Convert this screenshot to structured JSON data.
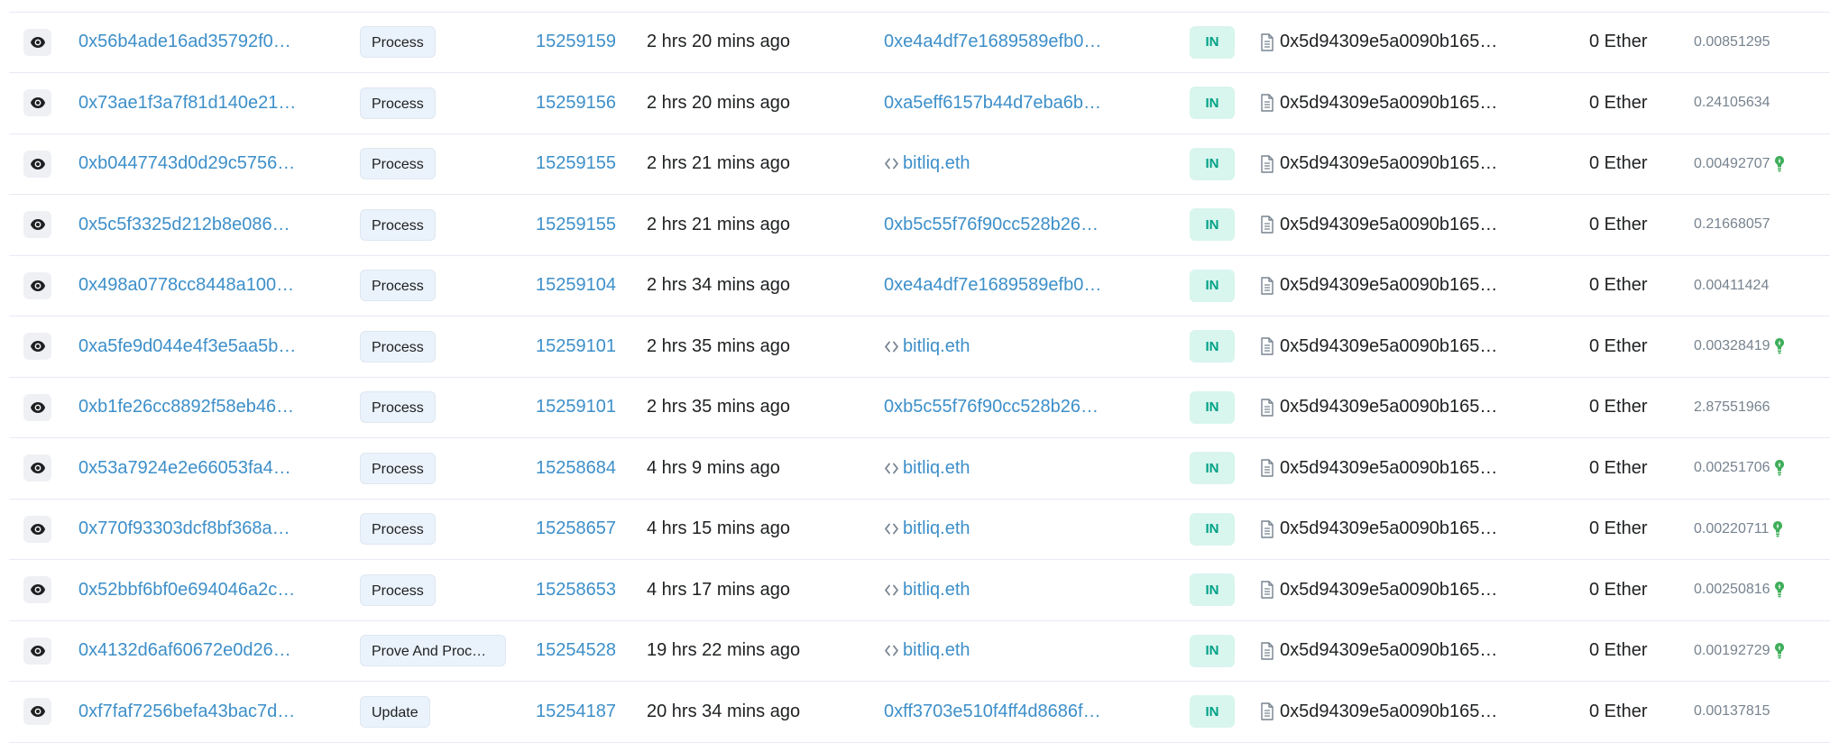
{
  "rows": [
    {
      "hash": "0x56b4ade16ad35792f0…",
      "method": "Process",
      "block": "15259159",
      "age": "2 hrs 20 mins ago",
      "from": "0xe4a4df7e1689589efb0…",
      "from_is_contract": false,
      "direction": "IN",
      "to": "0x5d94309e5a0090b165…",
      "value": "0 Ether",
      "fee": "0.00851295",
      "fee_bulb": false
    },
    {
      "hash": "0x73ae1f3a7f81d140e21…",
      "method": "Process",
      "block": "15259156",
      "age": "2 hrs 20 mins ago",
      "from": "0xa5eff6157b44d7eba6b…",
      "from_is_contract": false,
      "direction": "IN",
      "to": "0x5d94309e5a0090b165…",
      "value": "0 Ether",
      "fee": "0.24105634",
      "fee_bulb": false
    },
    {
      "hash": "0xb0447743d0d29c5756…",
      "method": "Process",
      "block": "15259155",
      "age": "2 hrs 21 mins ago",
      "from": "bitliq.eth",
      "from_is_contract": true,
      "direction": "IN",
      "to": "0x5d94309e5a0090b165…",
      "value": "0 Ether",
      "fee": "0.00492707",
      "fee_bulb": true
    },
    {
      "hash": "0x5c5f3325d212b8e086…",
      "method": "Process",
      "block": "15259155",
      "age": "2 hrs 21 mins ago",
      "from": "0xb5c55f76f90cc528b26…",
      "from_is_contract": false,
      "direction": "IN",
      "to": "0x5d94309e5a0090b165…",
      "value": "0 Ether",
      "fee": "0.21668057",
      "fee_bulb": false
    },
    {
      "hash": "0x498a0778cc8448a100…",
      "method": "Process",
      "block": "15259104",
      "age": "2 hrs 34 mins ago",
      "from": "0xe4a4df7e1689589efb0…",
      "from_is_contract": false,
      "direction": "IN",
      "to": "0x5d94309e5a0090b165…",
      "value": "0 Ether",
      "fee": "0.00411424",
      "fee_bulb": false
    },
    {
      "hash": "0xa5fe9d044e4f3e5aa5b…",
      "method": "Process",
      "block": "15259101",
      "age": "2 hrs 35 mins ago",
      "from": "bitliq.eth",
      "from_is_contract": true,
      "direction": "IN",
      "to": "0x5d94309e5a0090b165…",
      "value": "0 Ether",
      "fee": "0.00328419",
      "fee_bulb": true
    },
    {
      "hash": "0xb1fe26cc8892f58eb46…",
      "method": "Process",
      "block": "15259101",
      "age": "2 hrs 35 mins ago",
      "from": "0xb5c55f76f90cc528b26…",
      "from_is_contract": false,
      "direction": "IN",
      "to": "0x5d94309e5a0090b165…",
      "value": "0 Ether",
      "fee": "2.87551966",
      "fee_bulb": false
    },
    {
      "hash": "0x53a7924e2e66053fa4…",
      "method": "Process",
      "block": "15258684",
      "age": "4 hrs 9 mins ago",
      "from": "bitliq.eth",
      "from_is_contract": true,
      "direction": "IN",
      "to": "0x5d94309e5a0090b165…",
      "value": "0 Ether",
      "fee": "0.00251706",
      "fee_bulb": true
    },
    {
      "hash": "0x770f93303dcf8bf368a…",
      "method": "Process",
      "block": "15258657",
      "age": "4 hrs 15 mins ago",
      "from": "bitliq.eth",
      "from_is_contract": true,
      "direction": "IN",
      "to": "0x5d94309e5a0090b165…",
      "value": "0 Ether",
      "fee": "0.00220711",
      "fee_bulb": true
    },
    {
      "hash": "0x52bbf6bf0e694046a2c…",
      "method": "Process",
      "block": "15258653",
      "age": "4 hrs 17 mins ago",
      "from": "bitliq.eth",
      "from_is_contract": true,
      "direction": "IN",
      "to": "0x5d94309e5a0090b165…",
      "value": "0 Ether",
      "fee": "0.00250816",
      "fee_bulb": true
    },
    {
      "hash": "0x4132d6af60672e0d26…",
      "method": "Prove And Proces…",
      "block": "15254528",
      "age": "19 hrs 22 mins ago",
      "from": "bitliq.eth",
      "from_is_contract": true,
      "direction": "IN",
      "to": "0x5d94309e5a0090b165…",
      "value": "0 Ether",
      "fee": "0.00192729",
      "fee_bulb": true
    },
    {
      "hash": "0xf7faf7256befa43bac7d…",
      "method": "Update",
      "block": "15254187",
      "age": "20 hrs 34 mins ago",
      "from": "0xff3703e510f4ff4d8686f…",
      "from_is_contract": false,
      "direction": "IN",
      "to": "0x5d94309e5a0090b165…",
      "value": "0 Ether",
      "fee": "0.00137815",
      "fee_bulb": false
    }
  ],
  "icons": {
    "view": "eye-icon",
    "contract": "contract-code-icon",
    "to_contract": "document-icon",
    "fee_hint": "lightbulb-icon"
  },
  "colors": {
    "link": "#3d8fc9",
    "method_bg": "#eaf2fb",
    "in_badge_bg": "#d8f5ee",
    "in_badge_text": "#00a186",
    "bulb": "#3fae5a"
  }
}
